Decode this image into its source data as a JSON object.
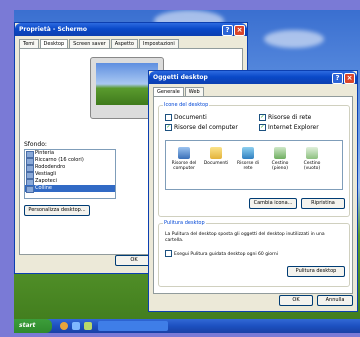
{
  "back_window": {
    "title": "Proprietà - Schermo",
    "tabs": [
      "Temi",
      "Desktop",
      "Screen saver",
      "Aspetto",
      "Impostazioni"
    ],
    "active_tab": 1,
    "sfondo_label": "Sfondo:",
    "sfondo_items": [
      "Pinteria",
      "Riccarno (16 colori)",
      "Rododendro",
      "Vestiagli",
      "Zapoteci",
      "Colline"
    ],
    "selected_item": 5,
    "customize_button": "Personalizza desktop...",
    "ok_button": "OK"
  },
  "front_window": {
    "title": "Oggetti desktop",
    "tabs": [
      "Generale",
      "Web"
    ],
    "active_tab": 0,
    "icons_group_label": "Icone del desktop",
    "checkboxes": [
      {
        "label": "Documenti",
        "checked": false
      },
      {
        "label": "Risorse di rete",
        "checked": true
      },
      {
        "label": "Risorse del computer",
        "checked": true
      },
      {
        "label": "Internet Explorer",
        "checked": true
      }
    ],
    "icons": [
      {
        "label": "Risorse del computer",
        "icon": "computer-icon"
      },
      {
        "label": "Documenti",
        "icon": "folder-icon"
      },
      {
        "label": "Risorse di rete",
        "icon": "network-icon"
      },
      {
        "label": "Cestino (pieno)",
        "icon": "trash-full-icon"
      },
      {
        "label": "Cestino (vuoto)",
        "icon": "trash-empty-icon"
      }
    ],
    "change_icon_button": "Cambia icona...",
    "restore_button": "Ripristina",
    "cleanup_group_label": "Pulitura desktop",
    "cleanup_text": "La Pulitura del desktop sposta gli oggetti del desktop inutilizzati in una cartella.",
    "cleanup_checkbox": {
      "label": "Esegui Pulitura guidata desktop ogni 60 giorni",
      "checked": false
    },
    "cleanup_button": "Pulitura desktop",
    "ok_button": "OK",
    "cancel_button": "Annulla"
  },
  "taskbar": {
    "start_label": "start"
  }
}
